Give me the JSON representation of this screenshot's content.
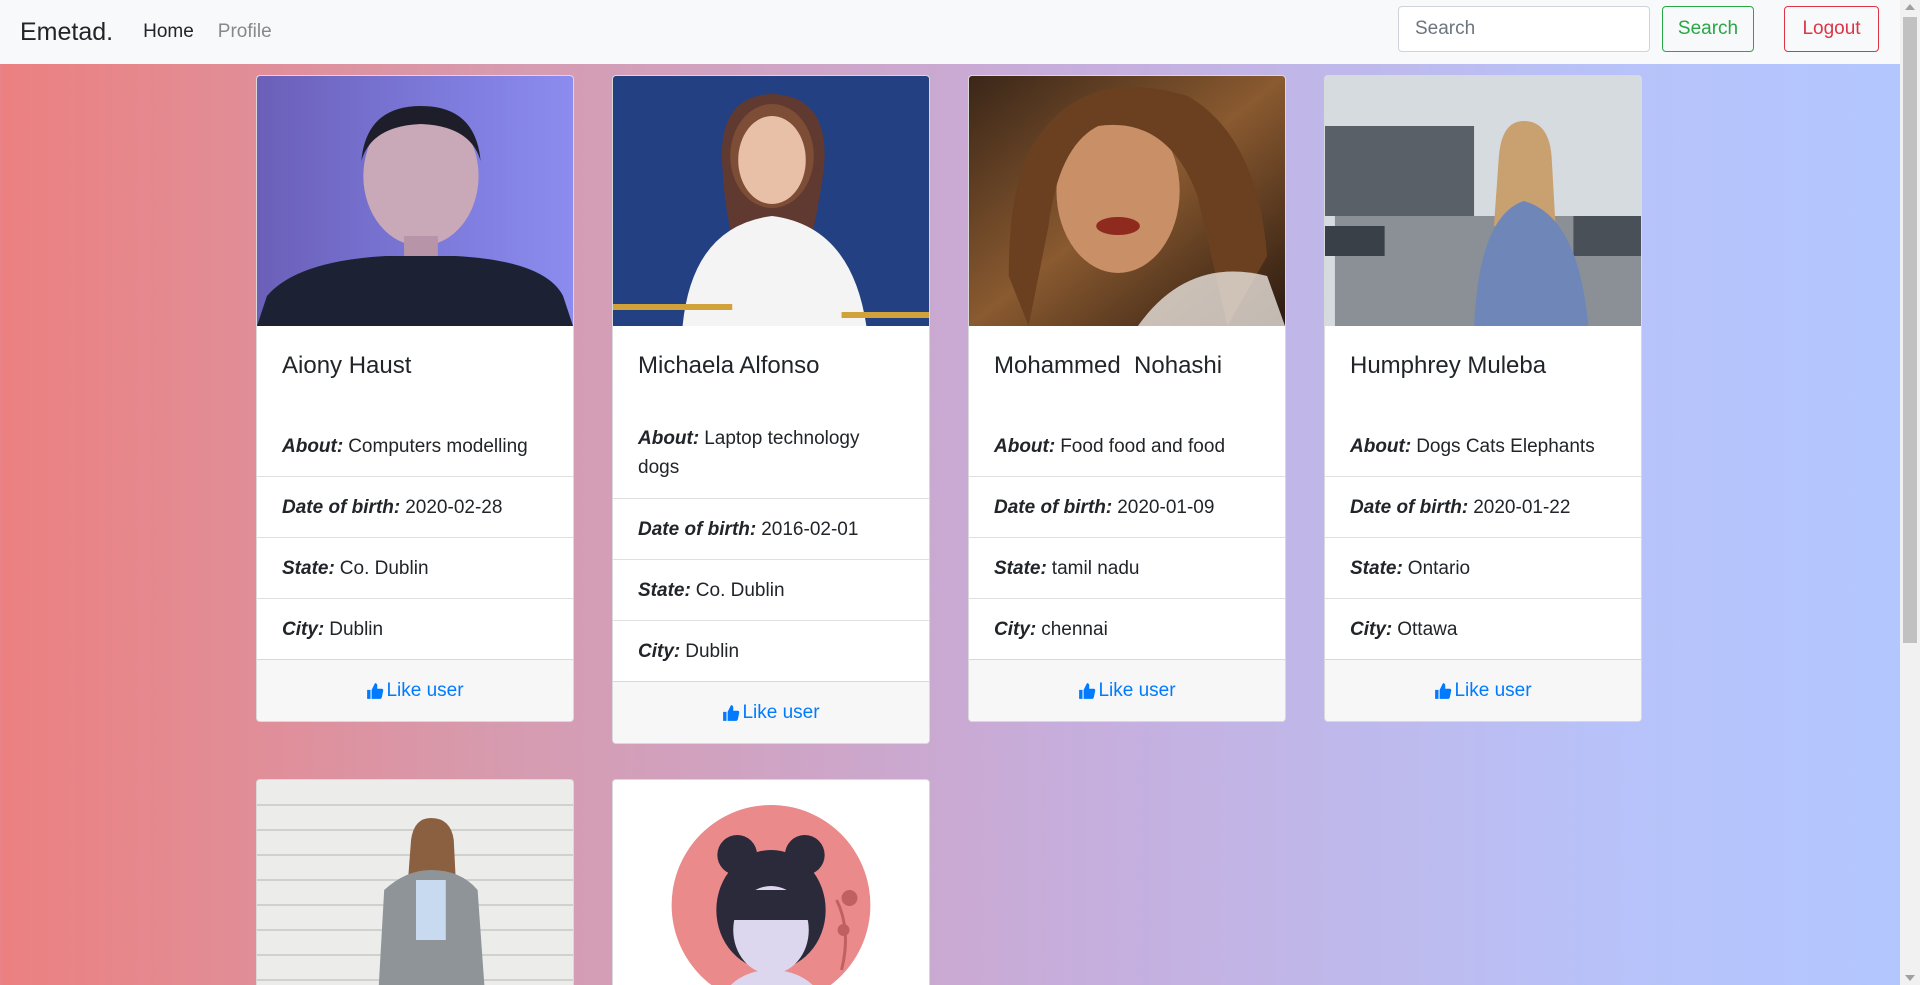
{
  "nav": {
    "brand": "Emetad.",
    "home": "Home",
    "profile": "Profile",
    "search_placeholder": "Search",
    "search_button": "Search",
    "logout_button": "Logout"
  },
  "labels": {
    "about": "About:",
    "dob": "Date of birth:",
    "state": "State:",
    "city": "City:",
    "like": "Like user"
  },
  "users": [
    {
      "name": "Aiony Haust",
      "about": "Computers modelling",
      "dob": "2020-02-28",
      "state": "Co. Dublin",
      "city": "Dublin"
    },
    {
      "name": "Michaela Alfonso",
      "about": "Laptop technology dogs",
      "dob": "2016-02-01",
      "state": "Co. Dublin",
      "city": "Dublin"
    },
    {
      "name": "Mohammed  Nohashi",
      "about": "Food food and food",
      "dob": "2020-01-09",
      "state": "tamil nadu",
      "city": "chennai"
    },
    {
      "name": "Humphrey Muleba",
      "about": "Dogs Cats Elephants",
      "dob": "2020-01-22",
      "state": "Ontario",
      "city": "Ottawa"
    }
  ],
  "colors": {
    "like_link": "#007bff",
    "search_button": "#28a745",
    "logout_button": "#dc3545"
  }
}
